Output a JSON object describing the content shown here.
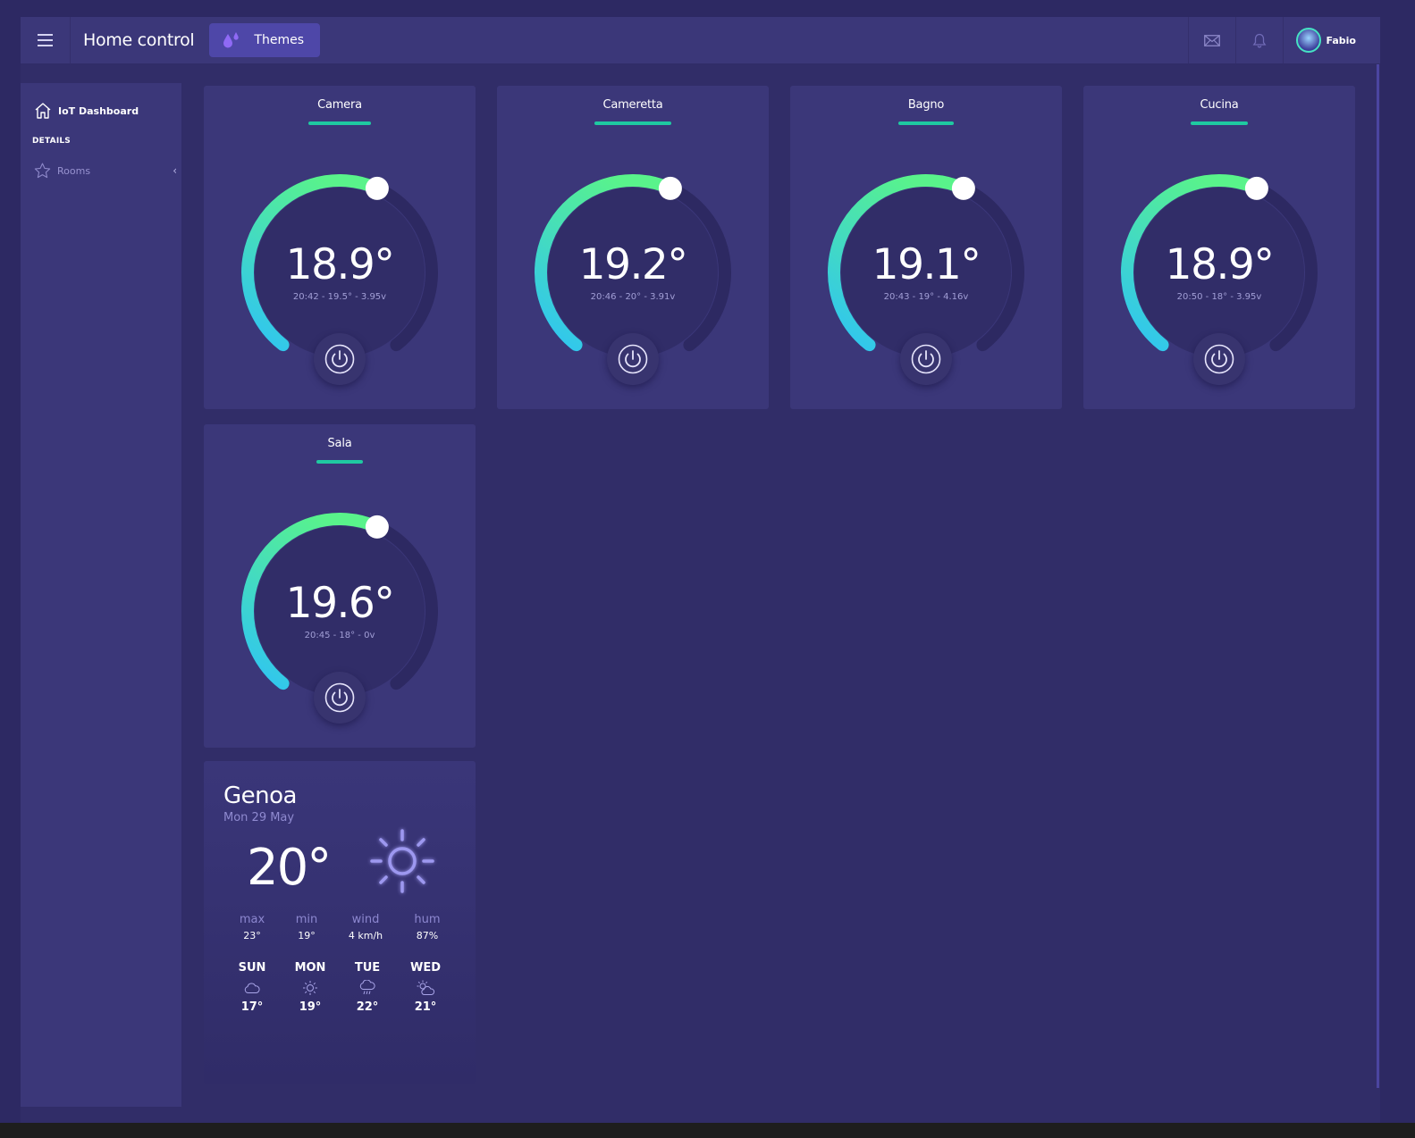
{
  "header": {
    "title": "Home control",
    "themes_label": "Themes",
    "user_name": "Fabio",
    "icons": [
      "menu-icon",
      "droplets-icon",
      "mail-icon",
      "bell-icon"
    ]
  },
  "sidebar": {
    "dashboard_label": "IoT Dashboard",
    "section_label": "DETAILS",
    "rooms_label": "Rooms"
  },
  "rooms": [
    {
      "name": "Camera",
      "temp": "18.9°",
      "info": "20:42 - 19.5° - 3.95v"
    },
    {
      "name": "Cameretta",
      "temp": "19.2°",
      "info": "20:46 - 20° - 3.91v"
    },
    {
      "name": "Bagno",
      "temp": "19.1°",
      "info": "20:43 - 19° - 4.16v"
    },
    {
      "name": "Cucina",
      "temp": "18.9°",
      "info": "20:50 - 18° - 3.95v"
    },
    {
      "name": "Sala",
      "temp": "19.6°",
      "info": "20:45 - 18° - 0v"
    }
  ],
  "weather": {
    "city": "Genoa",
    "date": "Mon 29 May",
    "temp": "20°",
    "icon": "sun-icon",
    "stats": [
      {
        "label": "max",
        "value": "23°"
      },
      {
        "label": "min",
        "value": "19°"
      },
      {
        "label": "wind",
        "value": "4 km/h"
      },
      {
        "label": "hum",
        "value": "87%"
      }
    ],
    "forecast": [
      {
        "day": "SUN",
        "icon": "cloud-icon",
        "temp": "17°"
      },
      {
        "day": "MON",
        "icon": "sun-icon",
        "temp": "19°"
      },
      {
        "day": "TUE",
        "icon": "rain-icon",
        "temp": "22°"
      },
      {
        "day": "WED",
        "icon": "partly-cloudy-icon",
        "temp": "21°"
      }
    ]
  },
  "colors": {
    "background": "#2d2963",
    "panel": "#3b3779",
    "accent": "#1fc9a1",
    "gauge_start": "#2ec3f5",
    "gauge_end": "#59f38b"
  }
}
